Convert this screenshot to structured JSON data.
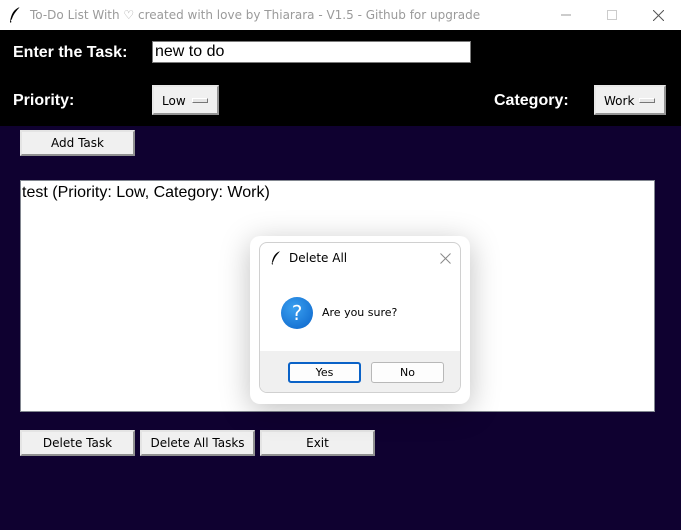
{
  "window": {
    "title": "To-Do List With ♡ created with love by Thiarara - V1.5 - Github for upgrade"
  },
  "header": {
    "task_label": "Enter the Task:",
    "task_value": "new to do",
    "priority_label": "Priority:",
    "priority_value": "Low",
    "category_label": "Category:",
    "category_value": "Work"
  },
  "buttons": {
    "add": "Add Task",
    "delete": "Delete Task",
    "delete_all": "Delete All Tasks",
    "exit": "Exit"
  },
  "tasks": [
    "test (Priority: Low, Category: Work)"
  ],
  "dialog": {
    "title": "Delete All",
    "message": "Are you sure?",
    "yes": "Yes",
    "no": "No",
    "icon": "question-icon"
  },
  "colors": {
    "header_bg": "#000000",
    "main_bg": "#0f0130",
    "accent": "#0a62c7"
  }
}
